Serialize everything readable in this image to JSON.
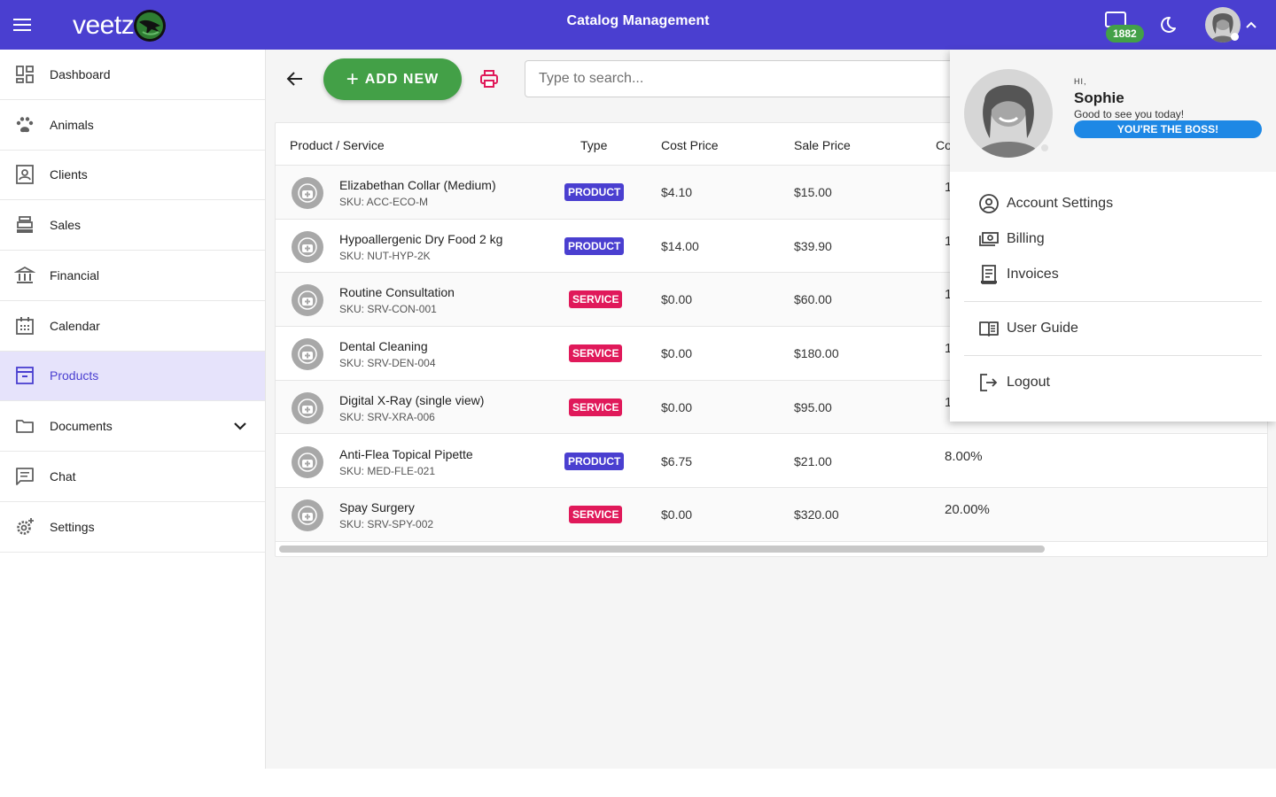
{
  "header": {
    "logo_text": "veetz",
    "title": "Catalog Management",
    "messages_count": "1882",
    "brand_color": "#4a3fd0"
  },
  "sidebar": {
    "items": [
      {
        "label": "Dashboard",
        "icon": "dashboard-icon"
      },
      {
        "label": "Animals",
        "icon": "paw-icon"
      },
      {
        "label": "Clients",
        "icon": "contact-card-icon"
      },
      {
        "label": "Sales",
        "icon": "cash-register-icon"
      },
      {
        "label": "Financial",
        "icon": "bank-icon"
      },
      {
        "label": "Calendar",
        "icon": "calendar-icon"
      },
      {
        "label": "Products",
        "icon": "archive-box-icon",
        "active": true
      },
      {
        "label": "Documents",
        "icon": "folder-icon"
      },
      {
        "label": "Chat",
        "icon": "chat-icon"
      },
      {
        "label": "Settings",
        "icon": "settings-icon"
      }
    ]
  },
  "toolbar": {
    "add_label": "ADD NEW",
    "search_placeholder": "Type to search..."
  },
  "table": {
    "headers": [
      "Product / Service",
      "Type",
      "Cost Price",
      "Sale Price",
      "Co"
    ],
    "rows": [
      {
        "name": "Elizabethan Collar (Medium)",
        "sku": "SKU: ACC-ECO-M",
        "type": "PRODUCT",
        "cost": "$4.10",
        "sale": "$15.00",
        "commission": "1"
      },
      {
        "name": "Hypoallergenic Dry Food 2 kg",
        "sku": "SKU: NUT-HYP-2K",
        "type": "PRODUCT",
        "cost": "$14.00",
        "sale": "$39.90",
        "commission": "1"
      },
      {
        "name": "Routine Consultation",
        "sku": "SKU: SRV-CON-001",
        "type": "SERVICE",
        "cost": "$0.00",
        "sale": "$60.00",
        "commission": "1"
      },
      {
        "name": "Dental Cleaning",
        "sku": "SKU: SRV-DEN-004",
        "type": "SERVICE",
        "cost": "$0.00",
        "sale": "$180.00",
        "commission": "1"
      },
      {
        "name": "Digital X-Ray (single view)",
        "sku": "SKU: SRV-XRA-006",
        "type": "SERVICE",
        "cost": "$0.00",
        "sale": "$95.00",
        "commission": "1"
      },
      {
        "name": "Anti-Flea Topical Pipette",
        "sku": "SKU: MED-FLE-021",
        "type": "PRODUCT",
        "cost": "$6.75",
        "sale": "$21.00",
        "commission": "8.00%"
      },
      {
        "name": "Spay Surgery",
        "sku": "SKU: SRV-SPY-002",
        "type": "SERVICE",
        "cost": "$0.00",
        "sale": "$320.00",
        "commission": "20.00%"
      }
    ],
    "product_color": "#4a3fd0",
    "service_color": "#e0195a"
  },
  "profile_menu": {
    "greeting_hi": "HI,",
    "user_name": "Sophie",
    "greeting": "Good to see you today!",
    "role_badge": "YOU'RE THE BOSS!",
    "items_top": [
      {
        "label": "Account Settings",
        "icon": "account-circle-icon"
      },
      {
        "label": "Billing",
        "icon": "cash-icon"
      },
      {
        "label": "Invoices",
        "icon": "receipt-icon"
      }
    ],
    "items_mid": [
      {
        "label": "User Guide",
        "icon": "book-icon"
      }
    ],
    "items_bottom": [
      {
        "label": "Logout",
        "icon": "logout-icon"
      }
    ]
  }
}
